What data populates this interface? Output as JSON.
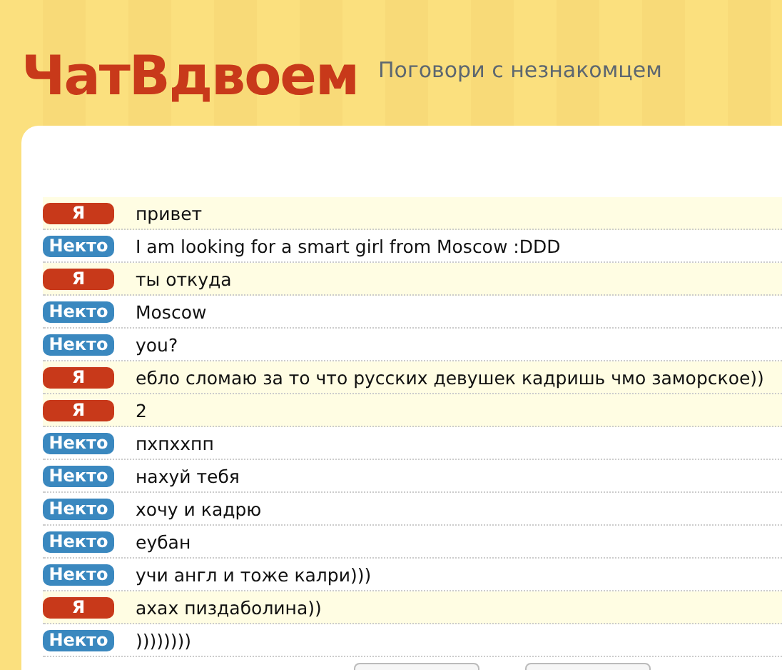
{
  "header": {
    "logo": "ЧатВдвоем",
    "tagline": "Поговори с незнакомцем"
  },
  "messages": [
    {
      "kind": "me",
      "sender": "Я",
      "text": "привет"
    },
    {
      "kind": "stranger",
      "sender": "Некто",
      "text": "I am looking for a smart girl from Moscow :DDD"
    },
    {
      "kind": "me",
      "sender": "Я",
      "text": "ты откуда"
    },
    {
      "kind": "stranger",
      "sender": "Некто",
      "text": "Moscow"
    },
    {
      "kind": "stranger",
      "sender": "Некто",
      "text": "you?"
    },
    {
      "kind": "me",
      "sender": "Я",
      "text": "ебло сломаю за то что русских девушек кадришь чмо заморское))"
    },
    {
      "kind": "me",
      "sender": "Я",
      "text": "2"
    },
    {
      "kind": "stranger",
      "sender": "Некто",
      "text": "пхпххпп"
    },
    {
      "kind": "stranger",
      "sender": "Некто",
      "text": "нахуй тебя"
    },
    {
      "kind": "stranger",
      "sender": "Некто",
      "text": "хочу и кадрю"
    },
    {
      "kind": "stranger",
      "sender": "Некто",
      "text": "еубан"
    },
    {
      "kind": "stranger",
      "sender": "Некто",
      "text": "учи англ и тоже калри)))"
    },
    {
      "kind": "me",
      "sender": "Я",
      "text": "ахах пиздаболина))"
    },
    {
      "kind": "stranger",
      "sender": "Некто",
      "text": "))))))))"
    }
  ]
}
